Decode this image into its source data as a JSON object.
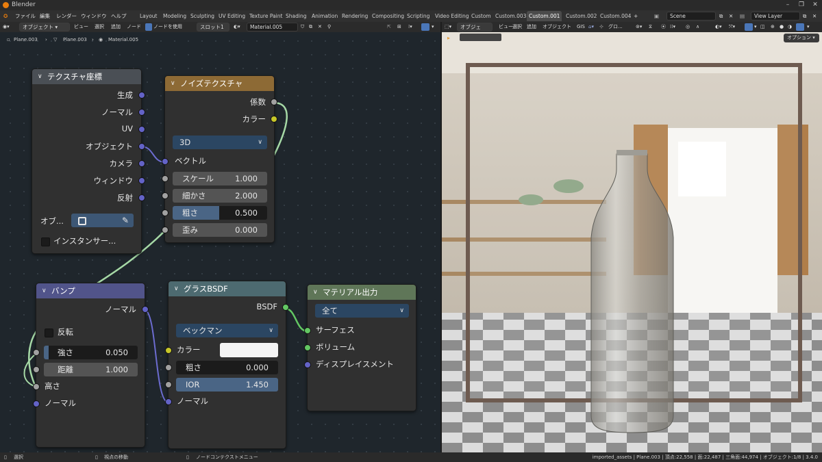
{
  "window": {
    "title": "Blender"
  },
  "menu": [
    "ファイル",
    "編集",
    "レンダー",
    "ウィンドウ",
    "ヘルプ"
  ],
  "workspaces": [
    "Layout",
    "Modeling",
    "Sculpting",
    "UV Editing",
    "Texture Paint",
    "Shading",
    "Animation",
    "Rendering",
    "Compositing",
    "Scripting",
    "Video Editing",
    "Custom",
    "Custom.003",
    "Custom.001",
    "Custom.002",
    "Custom.004"
  ],
  "active_workspace": "Custom.001",
  "scene": "Scene",
  "view_layer": "View Layer",
  "node_header": {
    "mode": "オブジェクト",
    "items": [
      "ビュー",
      "選択",
      "追加",
      "ノード"
    ],
    "use_nodes": "ノードを使用",
    "slot": "スロット1",
    "material": "Material.005"
  },
  "breadcrumb": [
    "Plane.003",
    "Plane.003",
    "Material.005"
  ],
  "viewport_header": {
    "mode": "オブジェク...",
    "items": [
      "ビュー",
      "選択",
      "追加",
      "オブジェクト",
      "GIS"
    ],
    "orientation": "グロ...",
    "options": "オプション"
  },
  "nodes": {
    "texcoord": {
      "title": "テクスチャ座標",
      "outputs": [
        "生成",
        "ノーマル",
        "UV",
        "オブジェクト",
        "カメラ",
        "ウィンドウ",
        "反射"
      ],
      "object_label": "オブ...",
      "instancer_label": "インスタンサー..."
    },
    "noise": {
      "title": "ノイズテクスチャ",
      "outputs": [
        "係数",
        "カラー"
      ],
      "dimension": "3D",
      "vector_label": "ベクトル",
      "inputs": [
        {
          "label": "スケール",
          "value": "1.000"
        },
        {
          "label": "細かさ",
          "value": "2.000"
        },
        {
          "label": "粗さ",
          "value": "0.500"
        },
        {
          "label": "歪み",
          "value": "0.000"
        }
      ]
    },
    "bump": {
      "title": "バンプ",
      "output": "ノーマル",
      "invert_label": "反転",
      "strength_label": "強さ",
      "strength_value": "0.050",
      "distance_label": "距離",
      "distance_value": "1.000",
      "height_label": "高さ",
      "normal_label": "ノーマル"
    },
    "glass": {
      "title": "グラスBSDF",
      "output": "BSDF",
      "distribution": "ベックマン",
      "color_label": "カラー",
      "roughness_label": "粗さ",
      "roughness_value": "0.000",
      "ior_label": "IOR",
      "ior_value": "1.450",
      "normal_label": "ノーマル"
    },
    "output": {
      "title": "マテリアル出力",
      "target": "全て",
      "inputs": [
        "サーフェス",
        "ボリューム",
        "ディスプレイスメント"
      ]
    }
  },
  "status": {
    "select": "選択",
    "move_view": "視点の移動",
    "context_menu": "ノードコンテクストメニュー",
    "stats": "imported_assets | Plane.003 | 頂点:22,558 | 面:22,487 | 三角面:44,974 | オブジェクト:1/8 | 3.4.0"
  },
  "colors": {
    "texture_header": "#8d6a35",
    "vector_header": "#51548a",
    "shader_header": "#4d6a70",
    "output_header": "#5f7658",
    "link_green": "#7fc77f"
  }
}
